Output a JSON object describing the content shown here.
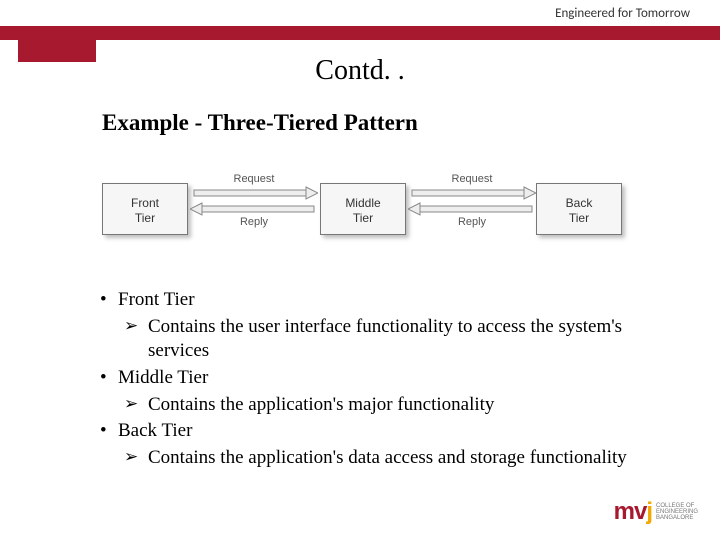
{
  "tagline": "Engineered for Tomorrow",
  "title": "Contd. .",
  "subtitle": "Example - Three-Tiered Pattern",
  "diagram": {
    "tiers": {
      "front": {
        "line1": "Front",
        "line2": "Tier"
      },
      "middle": {
        "line1": "Middle",
        "line2": "Tier"
      },
      "back": {
        "line1": "Back",
        "line2": "Tier"
      }
    },
    "arrows": {
      "request": "Request",
      "reply": "Reply"
    }
  },
  "bullets": [
    {
      "level": 1,
      "text": "Front Tier"
    },
    {
      "level": 2,
      "text": "Contains the user interface functionality to access the system's services"
    },
    {
      "level": 1,
      "text": "Middle Tier"
    },
    {
      "level": 2,
      "text": "Contains the application's major functionality"
    },
    {
      "level": 1,
      "text": "Back Tier"
    },
    {
      "level": 2,
      "text": "Contains the application's data access and storage functionality"
    }
  ],
  "logo": {
    "m": "m",
    "v": "v",
    "j": "j",
    "sub1": "COLLEGE OF",
    "sub2": "ENGINEERING",
    "sub3": "BANGALORE"
  },
  "colors": {
    "brand_red": "#a6192e",
    "brand_yellow": "#f2a900"
  }
}
